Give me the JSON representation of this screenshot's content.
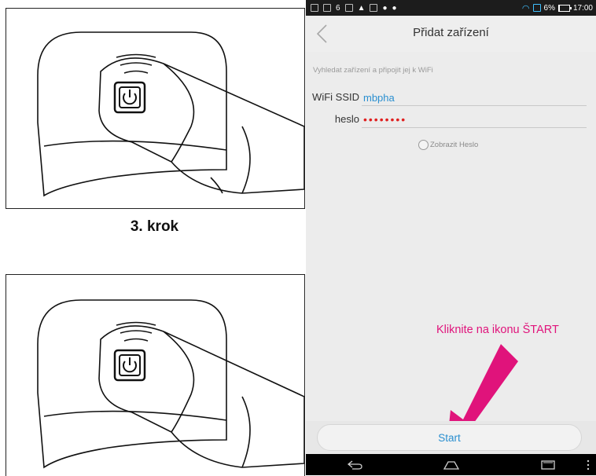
{
  "left": {
    "step_caption": "3. krok"
  },
  "phone": {
    "statusbar": {
      "battery_percent_text": "6%",
      "battery_level": 0.06,
      "time": "17:00",
      "notification_icons": [
        "sim-icon",
        "image-icon",
        "six-icon",
        "mail-icon",
        "warning-icon",
        "message-icon",
        "chat-icon",
        "chat2-icon"
      ]
    },
    "header": {
      "title": "Přidat zařízení",
      "back_icon": "chevron-left-icon"
    },
    "form": {
      "hint": "Vyhledat zařízení a připojit jej k WiFi",
      "ssid_label": "WiFi SSID",
      "ssid_value": "mbpha",
      "password_label": "heslo",
      "password_value": "••••••••",
      "show_password_label": "Zobrazit Heslo",
      "show_password_checked": false
    },
    "annotation": {
      "text": "Kliknite na ikonu ŠTART",
      "color": "#e0137b"
    },
    "start_button_label": "Start",
    "navbar_icons": [
      "back-icon",
      "home-icon",
      "recents-icon",
      "more-icon"
    ]
  }
}
